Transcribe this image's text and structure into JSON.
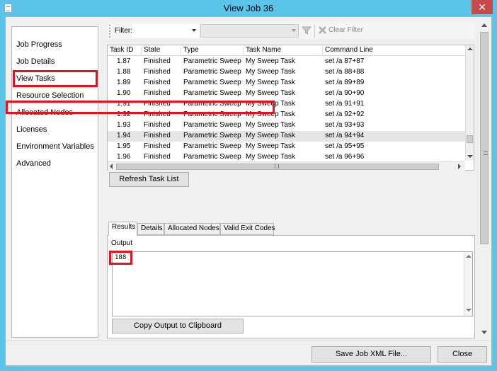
{
  "window": {
    "title": "View Job 36",
    "close_glyph": "✕"
  },
  "nav": {
    "items": [
      {
        "label": "Job Progress"
      },
      {
        "label": "Job Details"
      },
      {
        "label": "View Tasks"
      },
      {
        "label": "Resource Selection"
      },
      {
        "label": "Allocated Nodes"
      },
      {
        "label": "Licenses"
      },
      {
        "label": "Environment Variables"
      },
      {
        "label": "Advanced"
      }
    ],
    "selected": "View Tasks"
  },
  "toolbar": {
    "filter_label": "Filter:",
    "filter_field_value": "",
    "filter_value": "",
    "filter_icon": "funnel-icon",
    "clear_filter_label": "Clear Filter",
    "clear_icon": "clear-filter-x-icon"
  },
  "tasks": {
    "columns": [
      "Task ID",
      "State",
      "Type",
      "Task Name",
      "Command Line"
    ],
    "rows": [
      {
        "id": "1.87",
        "state": "Finished",
        "type": "Parametric Sweep",
        "name": "My Sweep Task",
        "command": "set /a 87+87"
      },
      {
        "id": "1.88",
        "state": "Finished",
        "type": "Parametric Sweep",
        "name": "My Sweep Task",
        "command": "set /a 88+88"
      },
      {
        "id": "1.89",
        "state": "Finished",
        "type": "Parametric Sweep",
        "name": "My Sweep Task",
        "command": "set /a 89+89"
      },
      {
        "id": "1.90",
        "state": "Finished",
        "type": "Parametric Sweep",
        "name": "My Sweep Task",
        "command": "set /a 90+90"
      },
      {
        "id": "1.91",
        "state": "Finished",
        "type": "Parametric Sweep",
        "name": "My Sweep Task",
        "command": "set /a 91+91"
      },
      {
        "id": "1.92",
        "state": "Finished",
        "type": "Parametric Sweep",
        "name": "My Sweep Task",
        "command": "set /a 92+92"
      },
      {
        "id": "1.93",
        "state": "Finished",
        "type": "Parametric Sweep",
        "name": "My Sweep Task",
        "command": "set /a 93+93"
      },
      {
        "id": "1.94",
        "state": "Finished",
        "type": "Parametric Sweep",
        "name": "My Sweep Task",
        "command": "set /a 94+94"
      },
      {
        "id": "1.95",
        "state": "Finished",
        "type": "Parametric Sweep",
        "name": "My Sweep Task",
        "command": "set /a 95+95"
      },
      {
        "id": "1.96",
        "state": "Finished",
        "type": "Parametric Sweep",
        "name": "My Sweep Task",
        "command": "set /a 96+96"
      }
    ],
    "selected_id": "1.94",
    "refresh_label": "Refresh Task List"
  },
  "details": {
    "tabs": [
      {
        "label": "Results"
      },
      {
        "label": "Details"
      },
      {
        "label": "Allocated Nodes"
      },
      {
        "label": "Valid Exit Codes"
      }
    ],
    "active_tab": "Results",
    "output_label": "Output",
    "output_value": "188",
    "copy_label": "Copy Output to Clipboard"
  },
  "footer": {
    "save_label": "Save Job XML File...",
    "close_label": "Close"
  },
  "colors": {
    "title_bar": "#5bc4e8",
    "close_button": "#c74a4a",
    "annotation_highlight": "#e0141e",
    "selected_row": "#e6e6e6"
  }
}
